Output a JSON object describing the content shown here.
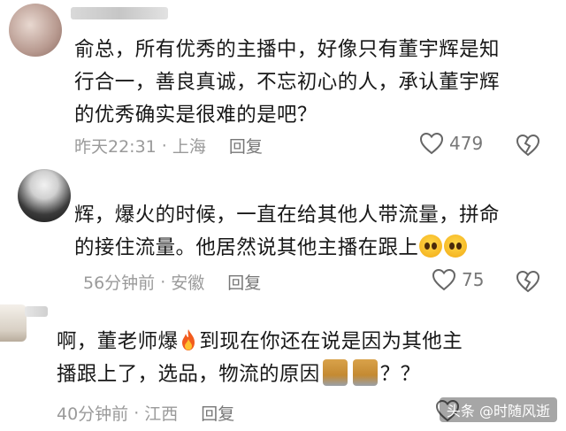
{
  "comments": [
    {
      "lines": [
        "俞总，所有优秀的主播中，好像只有董宇辉是知",
        "行合一，善良真诚，不忘初心的人，承认董宇辉",
        "的优秀确实是很难的是吧？"
      ],
      "time": "昨天22:31",
      "location": "上海",
      "reply_label": "回复",
      "likes": "479"
    },
    {
      "line1": "辉，爆火的时候，一直在给其他人带流量，拼命",
      "line2": "的接住流量。他居然说其他主播在跟上",
      "time": "56分钟前",
      "location": "安徽",
      "reply_label": "回复",
      "likes": "75"
    },
    {
      "line1a": "啊，董老师爆",
      "line1b": "到现在你还在说是因为其他主",
      "line2a": "播跟上了，选品，物流的原因",
      "line2b": "？？",
      "time": "40分钟前",
      "location": "江西",
      "reply_label": "回复"
    }
  ],
  "separator": "·",
  "watermark": "头条 @时随风逝",
  "icons": [
    "heart-icon",
    "broken-heart-icon",
    "grimace-emoji-icon",
    "fire-emoji-icon",
    "cat-sticker-icon"
  ]
}
